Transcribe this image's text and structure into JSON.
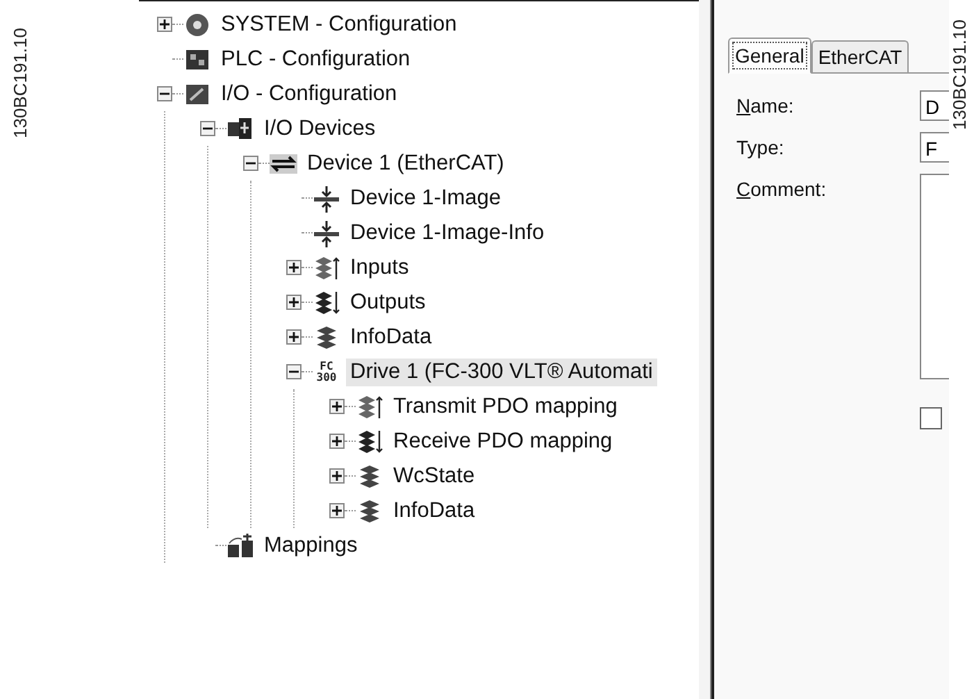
{
  "figure_codes": [
    "130BC191.10",
    "130BC191.10"
  ],
  "tree": [
    {
      "label": "SYSTEM - Configuration",
      "kind": "system",
      "expanded": false,
      "selected": false
    },
    {
      "label": "PLC - Configuration",
      "kind": "plc",
      "selected": false
    },
    {
      "label": "I/O - Configuration",
      "kind": "io",
      "expanded": true,
      "selected": false,
      "children": [
        {
          "label": "I/O Devices",
          "kind": "devices",
          "expanded": true,
          "selected": false,
          "children": [
            {
              "label": "Device 1 (EtherCAT)",
              "kind": "ethercat",
              "expanded": true,
              "selected": false,
              "children": [
                {
                  "label": "Device 1-Image",
                  "kind": "image",
                  "selected": false
                },
                {
                  "label": "Device 1-Image-Info",
                  "kind": "image",
                  "selected": false
                },
                {
                  "label": "Inputs",
                  "kind": "inputs",
                  "expanded": false,
                  "selected": false
                },
                {
                  "label": "Outputs",
                  "kind": "outputs",
                  "expanded": false,
                  "selected": false
                },
                {
                  "label": "InfoData",
                  "kind": "stack",
                  "expanded": false,
                  "selected": false
                },
                {
                  "label": "Drive 1 (FC-300 VLT® Automati",
                  "kind": "drive",
                  "icon_text": [
                    "FC",
                    "300"
                  ],
                  "expanded": true,
                  "selected": true,
                  "children": [
                    {
                      "label": "Transmit PDO mapping",
                      "kind": "inputs",
                      "expanded": false,
                      "selected": false
                    },
                    {
                      "label": "Receive PDO mapping",
                      "kind": "outputs",
                      "expanded": false,
                      "selected": false
                    },
                    {
                      "label": "WcState",
                      "kind": "stack",
                      "expanded": false,
                      "selected": false
                    },
                    {
                      "label": "InfoData",
                      "kind": "stack",
                      "expanded": false,
                      "selected": false
                    }
                  ]
                }
              ]
            }
          ]
        },
        {
          "label": "Mappings",
          "kind": "mappings",
          "selected": false
        }
      ]
    }
  ],
  "tabs": [
    {
      "label": "General",
      "selected": true
    },
    {
      "label": "EtherCAT",
      "selected": false
    }
  ],
  "form": {
    "name": {
      "label": "Name:",
      "value": "D"
    },
    "type": {
      "label": "Type:",
      "value": "F"
    },
    "comment": {
      "label": "Comment:"
    },
    "checkbox": {
      "checked": false
    }
  }
}
